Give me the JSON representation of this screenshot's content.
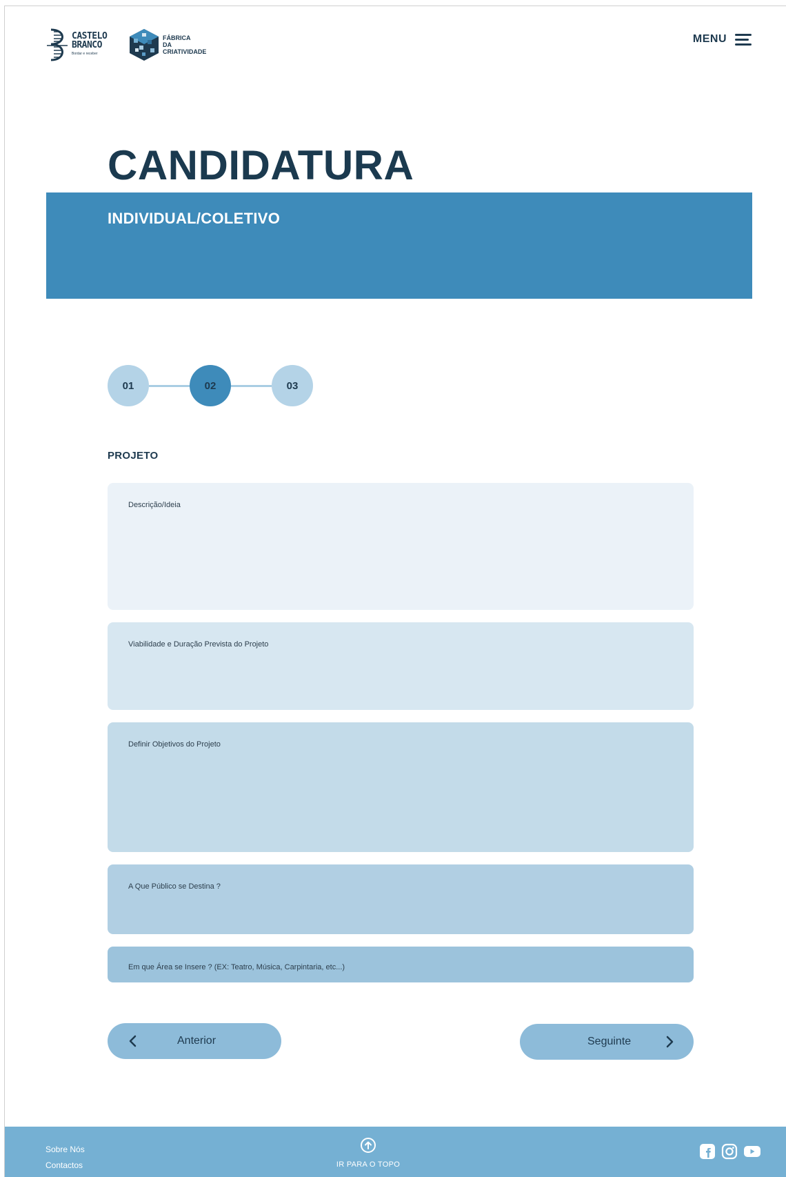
{
  "header": {
    "logo_castelo": {
      "line1": "CASTELO",
      "line2": "BRANCO",
      "tagline": "Bordar e receber"
    },
    "logo_fabrica": {
      "line1": "FÁBRICA",
      "line2": "DA",
      "line3": "CRIATIVIDADE"
    },
    "menu_label": "MENU"
  },
  "hero": {
    "title": "CANDIDATURA",
    "subtitle": "INDIVIDUAL/COLETIVO"
  },
  "stepper": {
    "steps": [
      "01",
      "02",
      "03"
    ],
    "active_step": "02"
  },
  "section": {
    "label": "PROJETO"
  },
  "fields": [
    {
      "placeholder": "Descrição/Ideia"
    },
    {
      "placeholder": "Viabilidade e Duração Prevista do Projeto"
    },
    {
      "placeholder": "Definir Objetivos do Projeto"
    },
    {
      "placeholder": "A Que Público se Destina ?"
    },
    {
      "placeholder": "Em que Área se Insere ? (EX: Teatro, Música, Carpintaria, etc...)"
    }
  ],
  "navigation": {
    "prev_label": "Anterior",
    "next_label": "Seguinte"
  },
  "footer": {
    "links": [
      "Sobre Nós",
      "Contactos"
    ],
    "to_top_label": "IR PARA O TOPO",
    "social_icons": [
      "facebook-icon",
      "instagram-icon",
      "youtube-icon"
    ]
  },
  "colors": {
    "navy": "#1e3a4f",
    "banner_blue": "#3e8bba",
    "footer_blue": "#75b0d3",
    "button_blue": "#8dbbd9"
  }
}
